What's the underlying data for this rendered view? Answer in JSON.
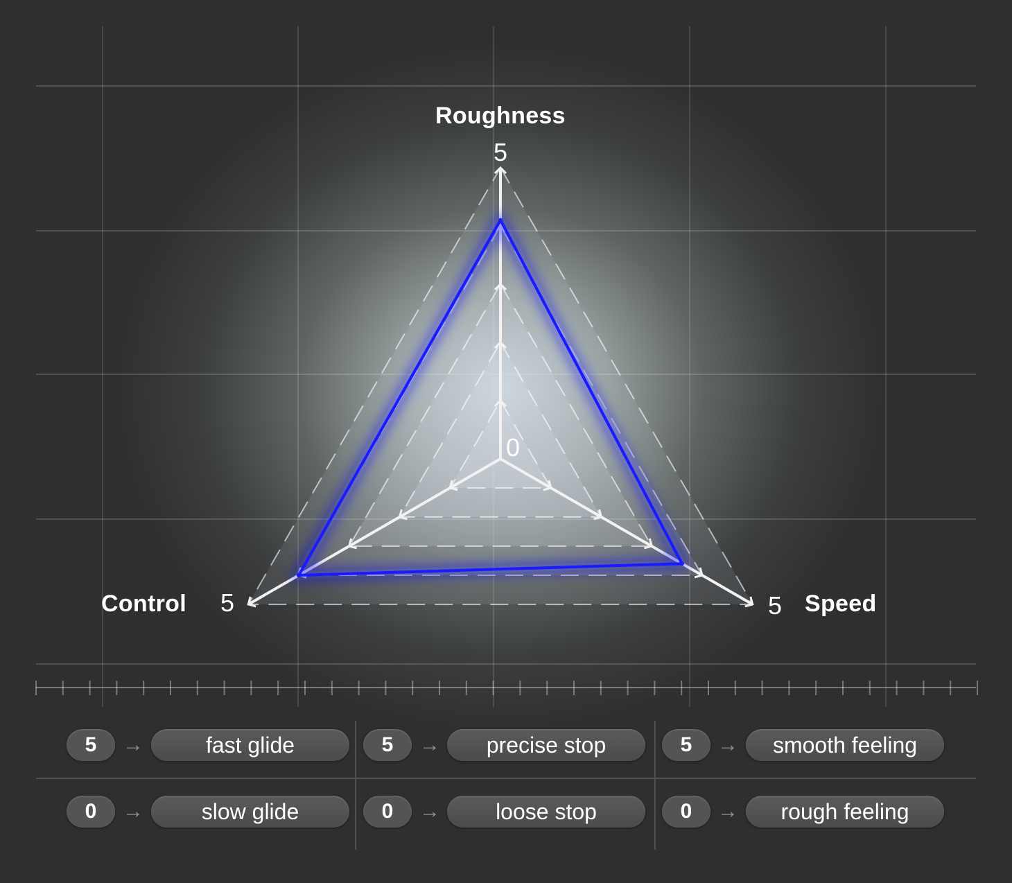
{
  "chart_data": {
    "type": "radar",
    "axes": [
      {
        "name": "Roughness",
        "min_label": "0",
        "max_label": "5"
      },
      {
        "name": "Speed",
        "max_label": "5"
      },
      {
        "name": "Control",
        "max_label": "5"
      }
    ],
    "range": [
      0,
      5
    ],
    "grid_levels": [
      1,
      2,
      3,
      4,
      5
    ],
    "series": [
      {
        "color": "#1a1aff",
        "values": {
          "Roughness": 4.1,
          "Speed": 3.6,
          "Control": 4.0
        }
      }
    ],
    "grid": true
  },
  "legend": {
    "columns": [
      {
        "max_value": "5",
        "max_label": "fast glide",
        "min_value": "0",
        "min_label": "slow glide"
      },
      {
        "max_value": "5",
        "max_label": "precise stop",
        "min_value": "0",
        "min_label": "loose stop"
      },
      {
        "max_value": "5",
        "max_label": "smooth feeling",
        "min_value": "0",
        "min_label": "rough feeling"
      }
    ],
    "arrow": "→"
  },
  "colors": {
    "series": "#1a1aff",
    "axis": "#ffffff",
    "badge": "#535455",
    "pill": "#505152"
  }
}
